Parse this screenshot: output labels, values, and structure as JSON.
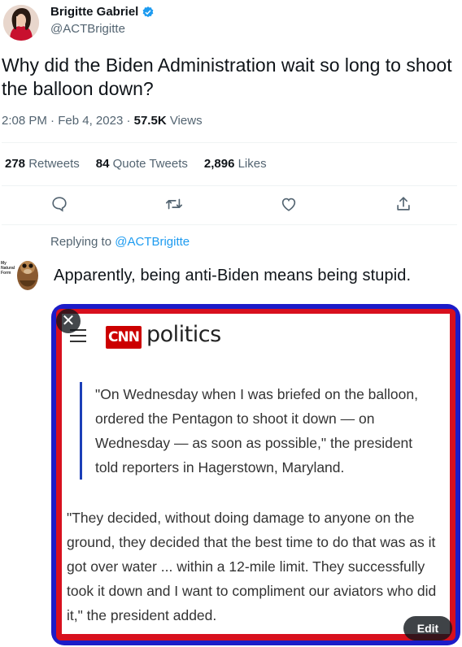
{
  "author": {
    "name": "Brigitte Gabriel",
    "handle": "@ACTBrigitte"
  },
  "tweet": {
    "text": "Why did the Biden Administration wait so long to shoot the balloon down?",
    "time": "2:08 PM",
    "date": "Feb 4, 2023",
    "views_count": "57.5K",
    "views_label": "Views"
  },
  "stats": {
    "retweets_count": "278",
    "retweets_label": "Retweets",
    "quotes_count": "84",
    "quotes_label": "Quote Tweets",
    "likes_count": "2,896",
    "likes_label": "Likes"
  },
  "actions": [
    "reply-icon",
    "retweet-icon",
    "like-icon",
    "share-icon"
  ],
  "reply": {
    "replying_prefix": "Replying to",
    "replying_handle": "@ACTBrigitte",
    "avatar_text": "My Natural Form",
    "text": "Apparently, being anti-Biden means being stupid."
  },
  "media": {
    "close_glyph": "✕",
    "edit_label": "Edit",
    "cnn_logo": "CNN",
    "section": "politics",
    "quote": "\"On Wednesday when I was briefed on the balloon, ordered the Pentagon to shoot it down — on Wednesday — as soon as possible,\" the president told reporters in Hagerstown, Maryland.",
    "paragraph": "\"They decided, without doing damage to anyone on the ground, they decided that the best time to do that was as it got over water ... within a 12-mile limit. They successfully took it down and I want to compliment our aviators who did it,\" the president added."
  },
  "colors": {
    "accent": "#1d9bf0",
    "media_border_outer": "#1c1cc8",
    "media_border_inner": "#d8101e",
    "cnn_red": "#cc0000"
  }
}
